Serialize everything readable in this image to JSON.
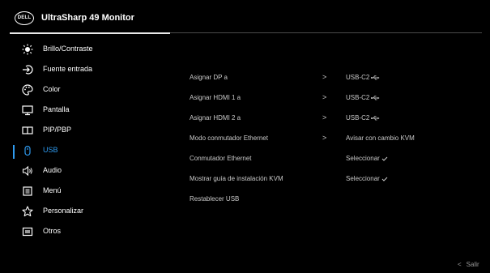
{
  "header": {
    "logo_text": "DELL",
    "title": "UltraSharp 49 Monitor"
  },
  "sidebar": {
    "items": [
      {
        "label": "Brillo/Contraste",
        "icon": "brightness-icon"
      },
      {
        "label": "Fuente entrada",
        "icon": "input-source-icon"
      },
      {
        "label": "Color",
        "icon": "color-palette-icon"
      },
      {
        "label": "Pantalla",
        "icon": "display-icon"
      },
      {
        "label": "PIP/PBP",
        "icon": "pip-pbp-icon"
      },
      {
        "label": "USB",
        "icon": "usb-mouse-icon",
        "active": true
      },
      {
        "label": "Audio",
        "icon": "speaker-icon"
      },
      {
        "label": "Menú",
        "icon": "menu-icon"
      },
      {
        "label": "Personalizar",
        "icon": "star-icon"
      },
      {
        "label": "Otros",
        "icon": "info-icon"
      }
    ]
  },
  "main": {
    "rows": [
      {
        "label": "Asignar DP a",
        "has_arrow": true,
        "arrow": ">",
        "value": "USB-C2",
        "value_icon": "usb-symbol-icon"
      },
      {
        "label": "Asignar HDMI 1 a",
        "has_arrow": true,
        "arrow": ">",
        "value": "USB-C2",
        "value_icon": "usb-symbol-icon"
      },
      {
        "label": "Asignar HDMI 2 a",
        "has_arrow": true,
        "arrow": ">",
        "value": "USB-C2",
        "value_icon": "usb-symbol-icon"
      },
      {
        "label": "Modo conmutador Ethernet",
        "has_arrow": true,
        "arrow": ">",
        "value": "Avisar con cambio KVM"
      },
      {
        "label": "Conmutador Ethernet",
        "has_arrow": false,
        "value": "Seleccionar",
        "value_icon": "checkmark-icon"
      },
      {
        "label": "Mostrar guía de instalación KVM",
        "has_arrow": false,
        "value": "Seleccionar",
        "value_icon": "checkmark-icon"
      },
      {
        "label": "Restablecer USB",
        "has_arrow": false,
        "value": ""
      }
    ]
  },
  "footer": {
    "exit_chevron": "<",
    "exit_label": "Salir"
  },
  "colors": {
    "accent": "#2f9bf0",
    "background": "#000000",
    "text": "#ffffff",
    "secondary_text": "#c9c9c9"
  }
}
